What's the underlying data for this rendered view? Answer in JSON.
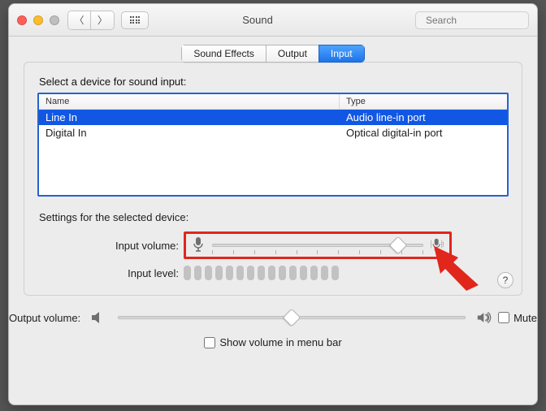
{
  "titlebar": {
    "title": "Sound",
    "search_placeholder": "Search"
  },
  "tabs": {
    "sound_effects": "Sound Effects",
    "output": "Output",
    "input": "Input"
  },
  "input_panel": {
    "select_label": "Select a device for sound input:",
    "cols": {
      "name": "Name",
      "type": "Type"
    },
    "devices": [
      {
        "name": "Line In",
        "type": "Audio line-in port",
        "selected": true
      },
      {
        "name": "Digital In",
        "type": "Optical digital-in port",
        "selected": false
      }
    ],
    "settings_label": "Settings for the selected device:",
    "input_volume_label": "Input volume:",
    "input_volume_percent": 88,
    "input_level_label": "Input level:",
    "input_level_segments": 15
  },
  "footer": {
    "output_volume_label": "Output volume:",
    "output_volume_percent": 50,
    "mute_label": "Mute",
    "mute_checked": false,
    "menu_bar_label": "Show volume in menu bar",
    "menu_bar_checked": false
  },
  "help_label": "?"
}
